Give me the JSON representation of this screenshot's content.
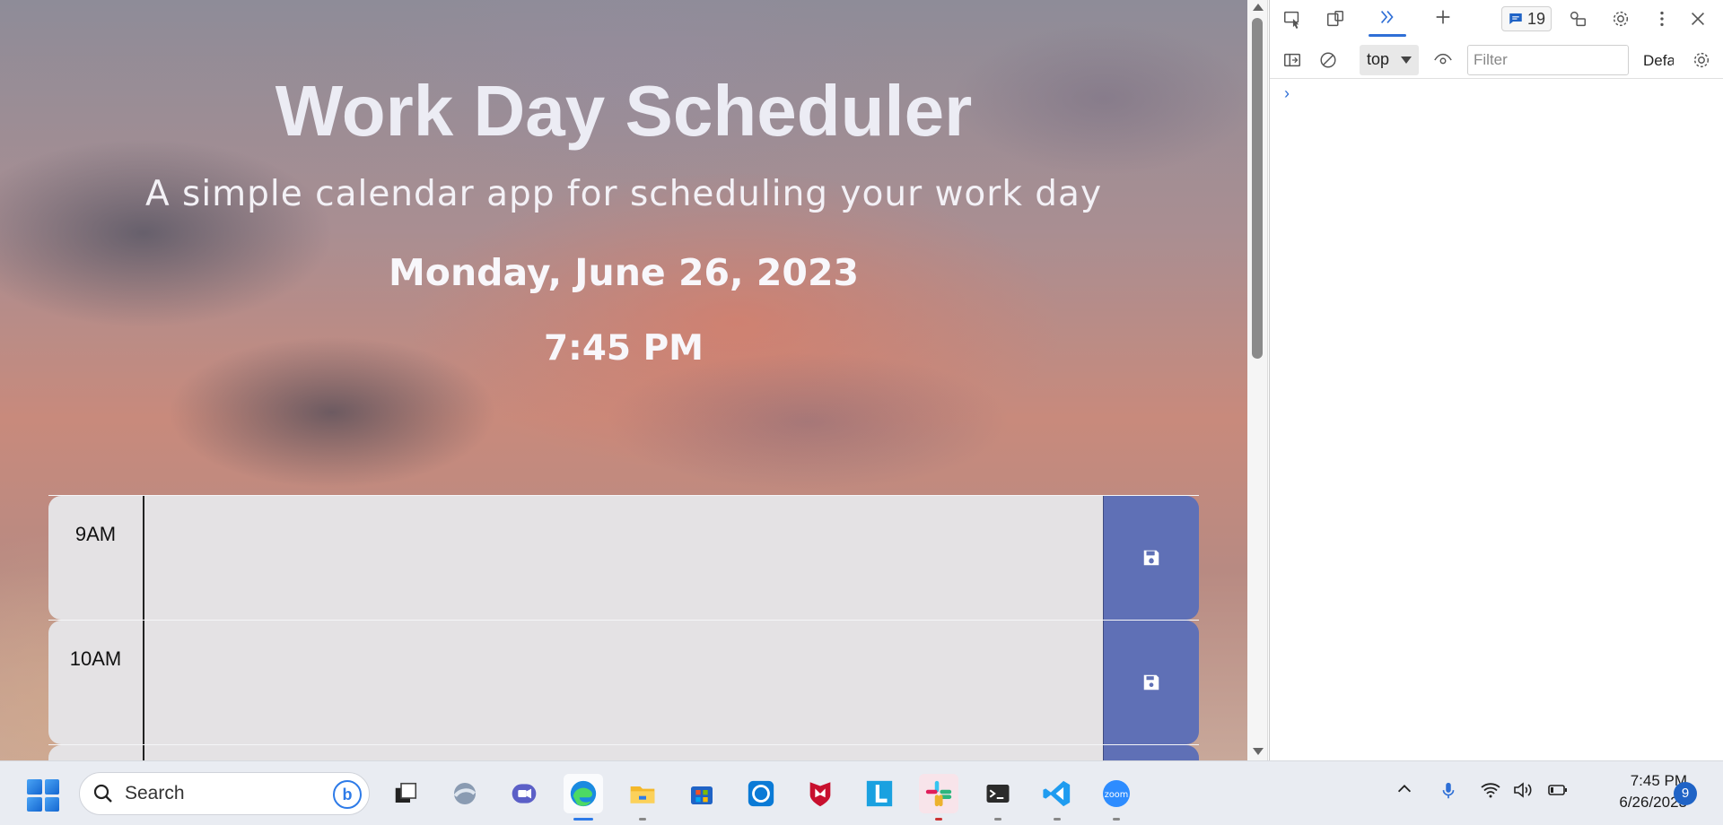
{
  "page": {
    "title": "Work Day Scheduler",
    "subtitle": "A simple calendar app for scheduling your work day",
    "date": "Monday, June 26, 2023",
    "time": "7:45 PM"
  },
  "schedule": {
    "rows": [
      {
        "hour": "9AM",
        "text": "",
        "state": "past"
      },
      {
        "hour": "10AM",
        "text": "",
        "state": "past"
      }
    ],
    "colors": {
      "past": "#e4e2e4",
      "save_button": "#5f70b6"
    }
  },
  "devtools": {
    "issues_count": "19",
    "context": "top",
    "filter_placeholder": "Filter",
    "levels": "Default"
  },
  "taskbar": {
    "search_placeholder": "Search",
    "apps": [
      "task-view",
      "copilot",
      "teams",
      "edge",
      "file-explorer",
      "microsoft-store",
      "cortana",
      "mcafee",
      "l-app",
      "slack",
      "terminal",
      "vscode",
      "zoom"
    ],
    "clock_time": "7:45 PM",
    "clock_date": "6/26/2023",
    "notification_count": "9"
  }
}
